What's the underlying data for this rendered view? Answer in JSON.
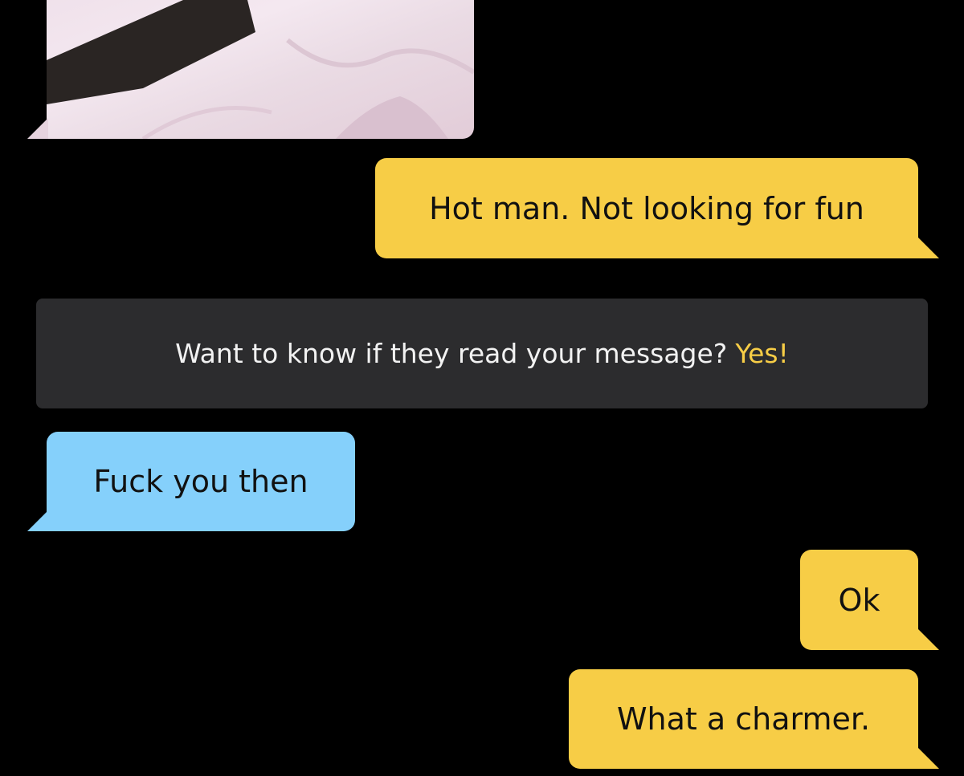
{
  "conversation": {
    "messages": [
      {
        "sender": "me",
        "text": "Hot man. Not looking for fun"
      },
      {
        "sender": "them",
        "text": "Fuck you then"
      },
      {
        "sender": "me",
        "text": "Ok"
      },
      {
        "sender": "me",
        "text": "What a charmer."
      }
    ],
    "read_receipt_banner": {
      "prompt": "Want to know if they read your message?",
      "action": "Yes!"
    }
  },
  "colors": {
    "background": "#000000",
    "outgoing_bubble": "#f7cd46",
    "incoming_bubble": "#85d0fb",
    "banner": "#2c2c2e",
    "accent": "#f7cd46"
  }
}
